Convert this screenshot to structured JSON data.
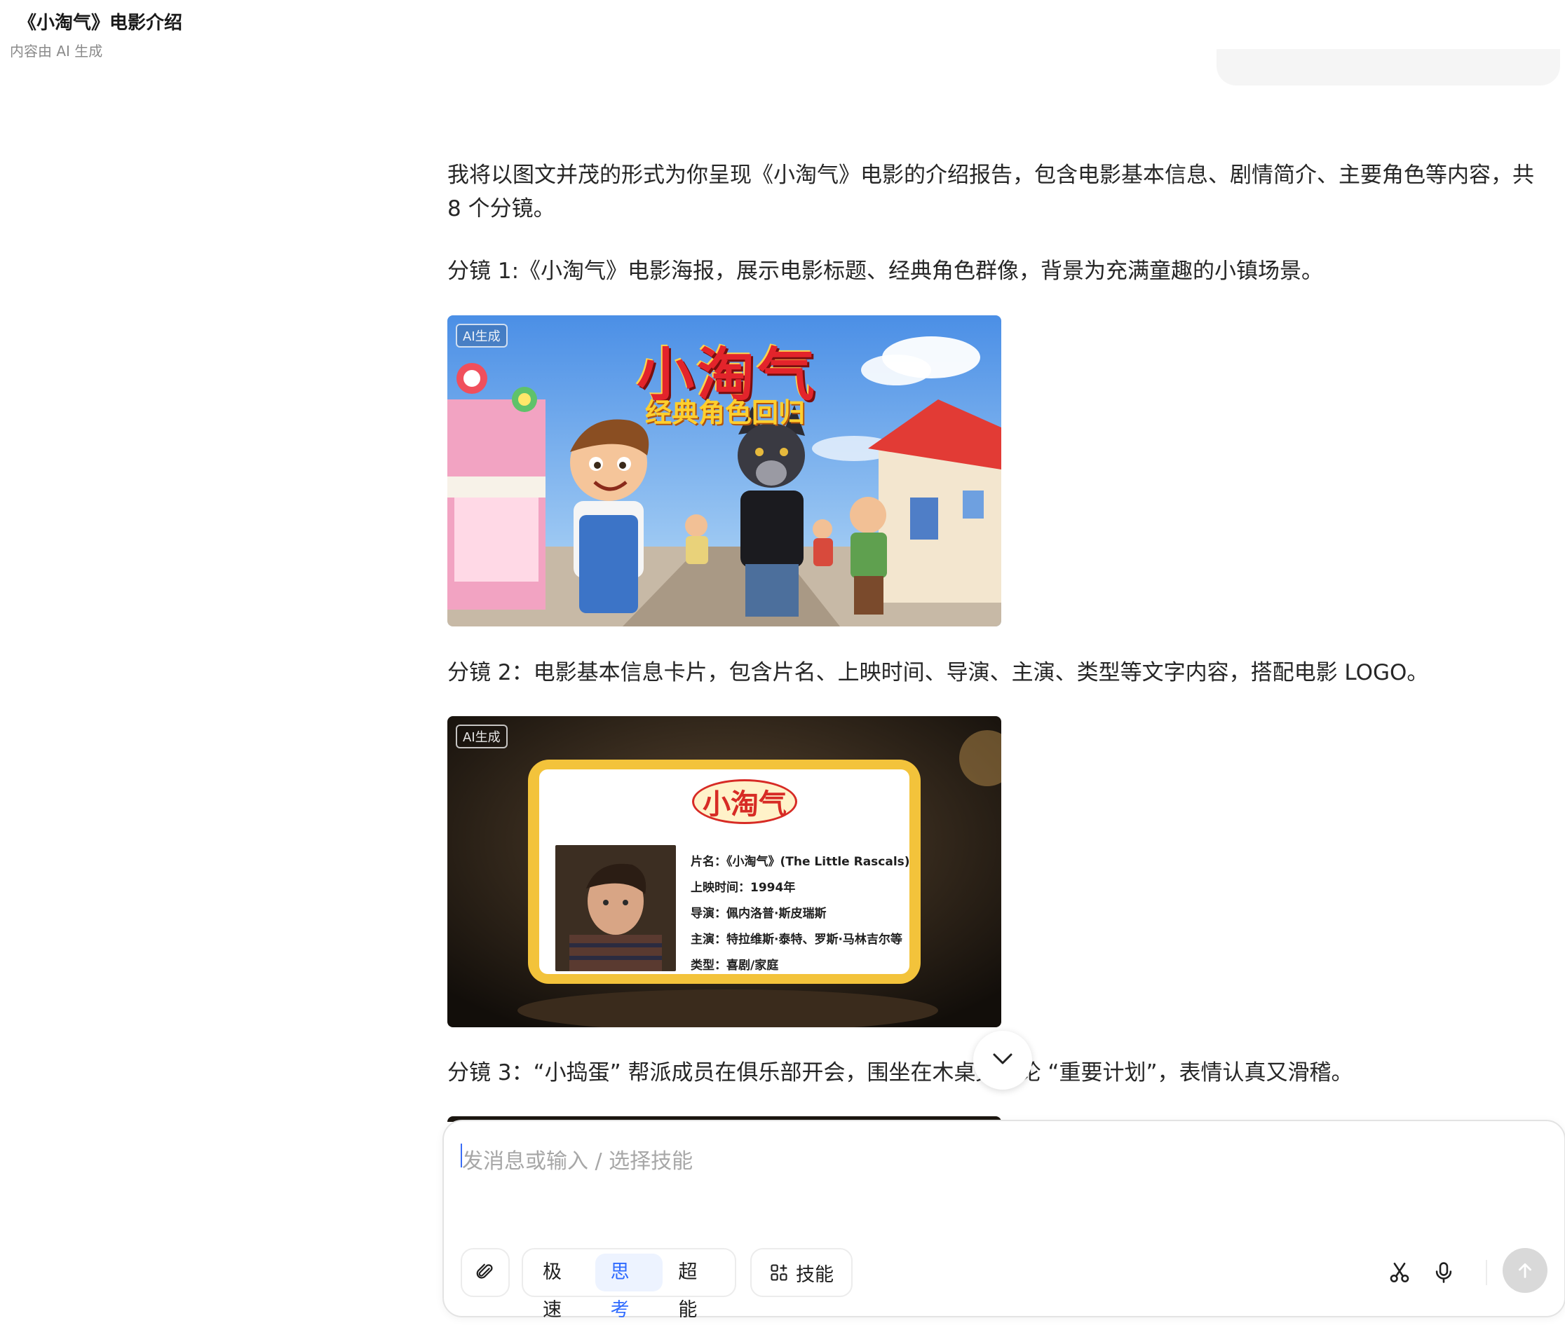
{
  "header": {
    "title": "《小淘气》电影介绍",
    "subtitle": "内容由 AI 生成"
  },
  "message": {
    "intro": "我将以图文并茂的形式为你呈现《小淘气》电影的介绍报告，包含电影基本信息、剧情简介、主要角色等内容，共 8 个分镜。",
    "shot1": "分镜 1:《小淘气》电影海报，展示电影标题、经典角色群像，背景为充满童趣的小镇场景。",
    "shot2": "分镜 2：电影基本信息卡片，包含片名、上映时间、导演、主演、类型等文字内容，搭配电影 LOGO。",
    "shot3": "分镜 3：“小捣蛋” 帮派成员在俱乐部开会，围坐在木桌旁讨论 “重要计划”，表情认真又滑稽。"
  },
  "image1": {
    "ai_badge": "AI生成",
    "poster_title": "小淘气",
    "poster_subtitle": "经典角色回归"
  },
  "image2": {
    "ai_badge": "AI生成",
    "logo": "小淘气",
    "lines": [
      "片名：《小淘气》(The Little Rascals)",
      "上映时间：1994年",
      "导演：佩内洛普·斯皮瑞斯",
      "主演：特拉维斯·泰特、罗斯·马林吉尔等",
      "类型：喜剧/家庭"
    ]
  },
  "composer": {
    "placeholder": "发消息或输入 / 选择技能",
    "modes": [
      "极速",
      "思考",
      "超能"
    ],
    "active_mode": "思考",
    "skills_label": "技能"
  },
  "colors": {
    "accent": "#2f6bff",
    "active_mode_bg": "#edf3ff",
    "send_disabled": "#d9d9d9",
    "card_gold": "#f3c33b",
    "poster_red": "#e3242b"
  },
  "icons": [
    "chevron-down-icon",
    "paperclip-icon",
    "skills-grid-icon",
    "scissors-icon",
    "microphone-icon",
    "arrow-up-icon"
  ]
}
